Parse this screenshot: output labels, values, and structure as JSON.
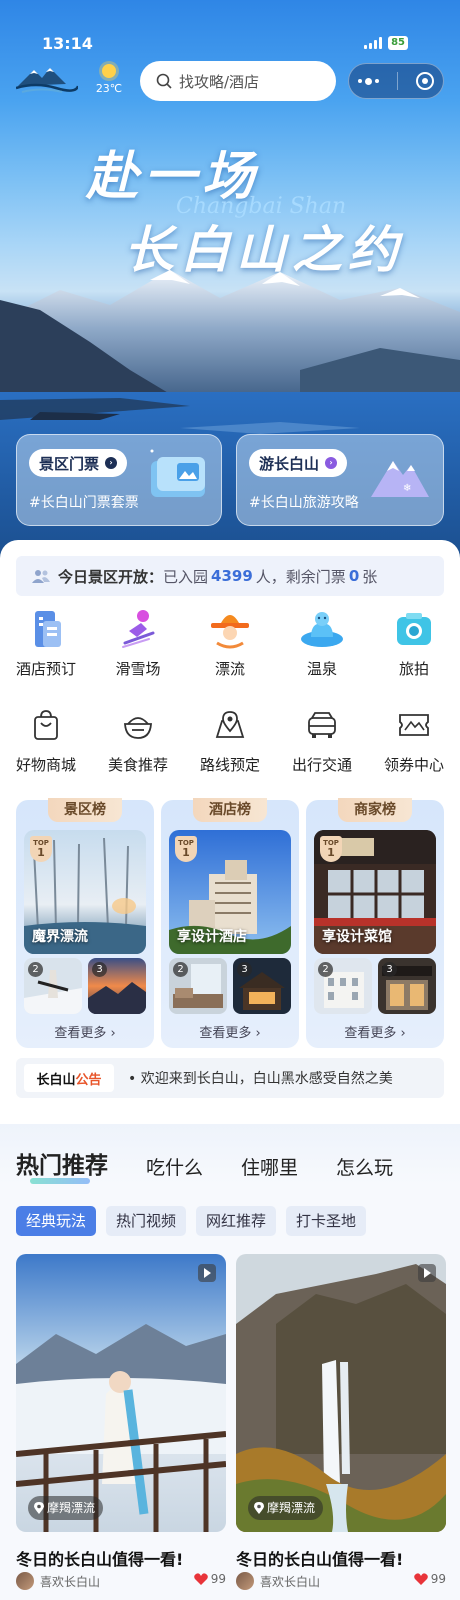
{
  "status": {
    "time": "13:14",
    "battery": "85"
  },
  "header": {
    "weather_temp": "23℃",
    "search_placeholder": "找攻略/酒店"
  },
  "hero": {
    "title_line1": "赴一场",
    "title_line2": "长白山之约",
    "pinyin": "Changbai Shan"
  },
  "quick_cards": [
    {
      "label": "景区门票",
      "tag": "#长白山门票套票"
    },
    {
      "label": "游长白山",
      "tag": "#长白山旅游攻略"
    }
  ],
  "notice": {
    "label": "今日景区开放：",
    "entered_prefix": "已入园",
    "entered": "4399",
    "entered_suffix": "人，",
    "remain_prefix": "剩余门票",
    "remain": "0",
    "remain_suffix": "张"
  },
  "services_row1": [
    {
      "label": "酒店预订",
      "icon": "hotel-icon"
    },
    {
      "label": "滑雪场",
      "icon": "ski-icon"
    },
    {
      "label": "漂流",
      "icon": "rafting-icon"
    },
    {
      "label": "温泉",
      "icon": "hot-spring-icon"
    },
    {
      "label": "旅拍",
      "icon": "camera-icon"
    }
  ],
  "services_row2": [
    {
      "label": "好物商城",
      "icon": "shopping-bag-icon"
    },
    {
      "label": "美食推荐",
      "icon": "food-bowl-icon"
    },
    {
      "label": "路线预定",
      "icon": "map-pin-icon"
    },
    {
      "label": "出行交通",
      "icon": "car-icon"
    },
    {
      "label": "领券中心",
      "icon": "ticket-icon"
    }
  ],
  "rankings": [
    {
      "header": "景区榜",
      "top_name": "魔界漂流",
      "top_badge": "TOP",
      "n2": "2",
      "n3": "3",
      "more": "查看更多 ›"
    },
    {
      "header": "酒店榜",
      "top_name": "享设计酒店",
      "top_badge": "TOP",
      "n2": "2",
      "n3": "3",
      "more": "查看更多 ›"
    },
    {
      "header": "商家榜",
      "top_name": "享设计菜馆",
      "top_badge": "TOP",
      "n2": "2",
      "n3": "3",
      "more": "查看更多 ›"
    }
  ],
  "rank_first": "1",
  "announcement": {
    "brand_a": "长白山",
    "brand_b": "公告",
    "text": "• 欢迎来到长白山，白山黑水感受自然之美"
  },
  "feed": {
    "tabs": [
      "热门推荐",
      "吃什么",
      "住哪里",
      "怎么玩"
    ],
    "chips": [
      "经典玩法",
      "热门视频",
      "网红推荐",
      "打卡圣地"
    ],
    "posts": [
      {
        "location": "摩羯漂流",
        "title": "冬日的长白山值得一看!",
        "user": "喜欢长白山",
        "likes": "99"
      },
      {
        "location": "摩羯漂流",
        "title": "冬日的长白山值得一看!",
        "user": "喜欢长白山",
        "likes": "99"
      }
    ]
  },
  "colors": {
    "accent": "#4b7ee6",
    "notice_number": "#3b6ed8",
    "announce_red": "#e8552a"
  }
}
